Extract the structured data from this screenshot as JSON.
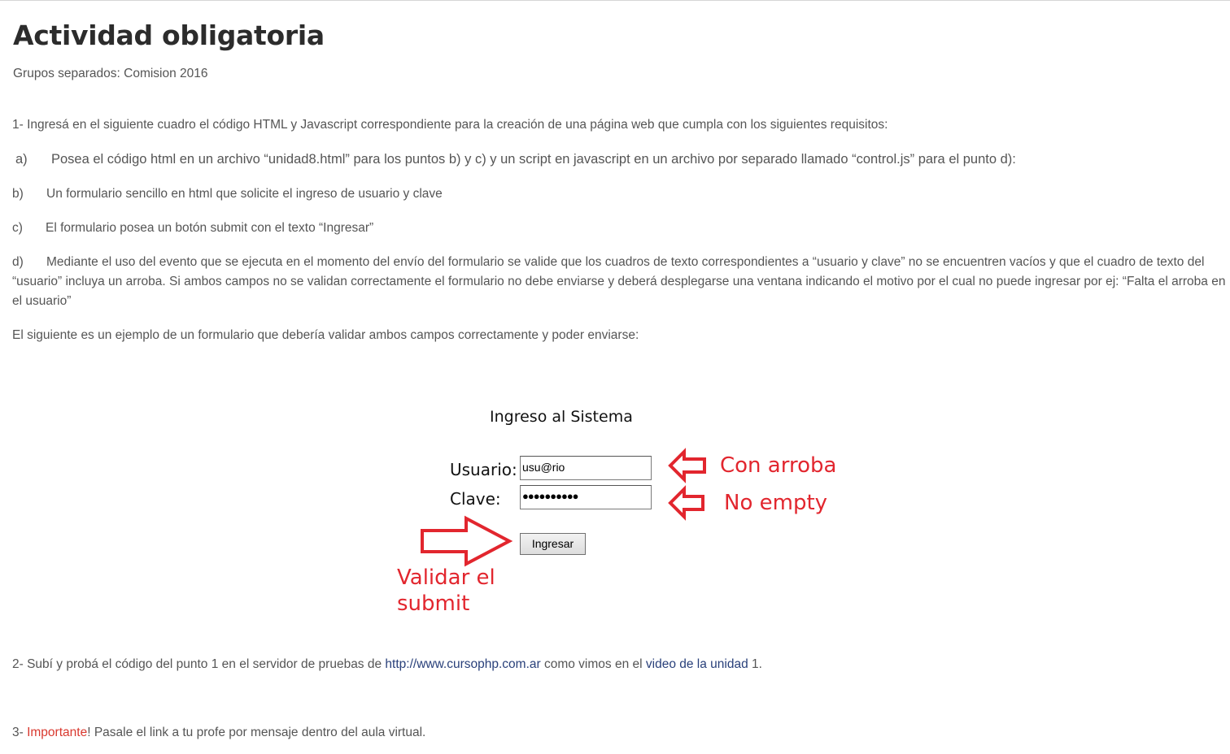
{
  "page": {
    "title": "Actividad obligatoria",
    "groups": "Grupos separados: Comision 2016"
  },
  "activity": {
    "p1": "1- Ingresá en el siguiente cuadro el código HTML y Javascript correspondiente para la creación de una página web que cumpla con los siguientes requisitos:",
    "a_marker": "a)",
    "a_text": "Posea el código html en un archivo “unidad8.html” para los puntos b) y c) y un script en javascript en un archivo por separado llamado “control.js” para el punto d):",
    "b_marker": "b)",
    "b_text": "Un formulario sencillo en html que solicite el ingreso de usuario y clave",
    "c_marker": "c)",
    "c_text": "El formulario posea un botón submit con el texto “Ingresar”",
    "d_marker": "d)",
    "d_text": "Mediante el uso del evento que se ejecuta en el momento del envío del formulario se valide que los cuadros de texto correspondientes a “usuario y clave” no se encuentren vacíos y que el cuadro de texto del “usuario” incluya un arroba. Si ambos campos no se validan correctamente el formulario no debe enviarse y deberá desplegarse una ventana indicando el motivo por el cual no puede ingresar por ej: “Falta el arroba en el usuario”",
    "example": "El siguiente es un ejemplo de un formulario que debería validar ambos campos correctamente y poder enviarse:"
  },
  "form_image": {
    "title": "Ingreso al Sistema",
    "user_label": "Usuario:",
    "user_value": "usu@rio",
    "pass_label": "Clave:",
    "pass_value": "●●●●●●●●●●",
    "button_label": "Ingresar",
    "anno_user": "Con arroba",
    "anno_pass": "No empty",
    "anno_submit": "Validar el submit",
    "anno_color": "#e2262e"
  },
  "step2": {
    "prefix": "2- Subí y probá el código del punto 1 en el servidor de pruebas de ",
    "link1": "http://www.cursophp.com.ar",
    "middle": " como vimos en el ",
    "link2": "video de la unidad",
    "suffix": " 1."
  },
  "step3": {
    "prefix": "3- ",
    "important": "Importante",
    "suffix": "! Pasale el link a tu profe por mensaje dentro del aula virtual."
  },
  "colors": {
    "link": "#29407a",
    "important": "#d9392f",
    "text": "#555555",
    "title": "#2c2c2c"
  }
}
